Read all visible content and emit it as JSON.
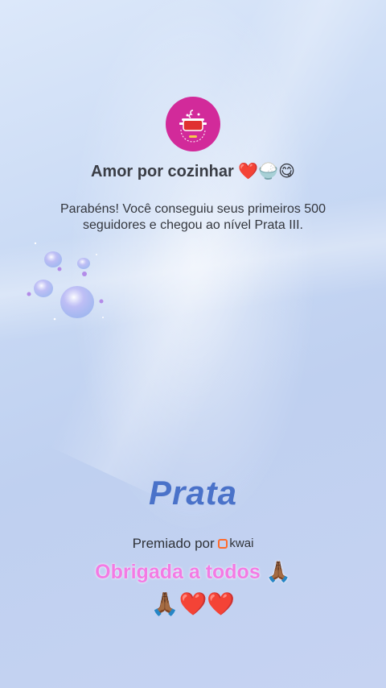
{
  "profile": {
    "name": "Amor por cozinhar",
    "name_emojis": "❤️🍚😋"
  },
  "message": "Parabéns! Você conseguiu seus primeiros 500 seguidores e chegou ao nível Prata III.",
  "level": "Prata",
  "award": {
    "prefix": "Premiado por",
    "brand": "kwai"
  },
  "caption": {
    "line1": "Obrigada a todos",
    "line1_emoji": "🙏🏾",
    "line2": "🙏🏾❤️❤️"
  },
  "colors": {
    "avatar_bg": "#d22a9a",
    "level_text": "#4a72c9",
    "caption_text": "#f37be4",
    "brand_orange": "#ff6a2b"
  },
  "icons": [
    "cooking-pot-logo",
    "bubbles-decoration",
    "kwai-logo-icon"
  ]
}
